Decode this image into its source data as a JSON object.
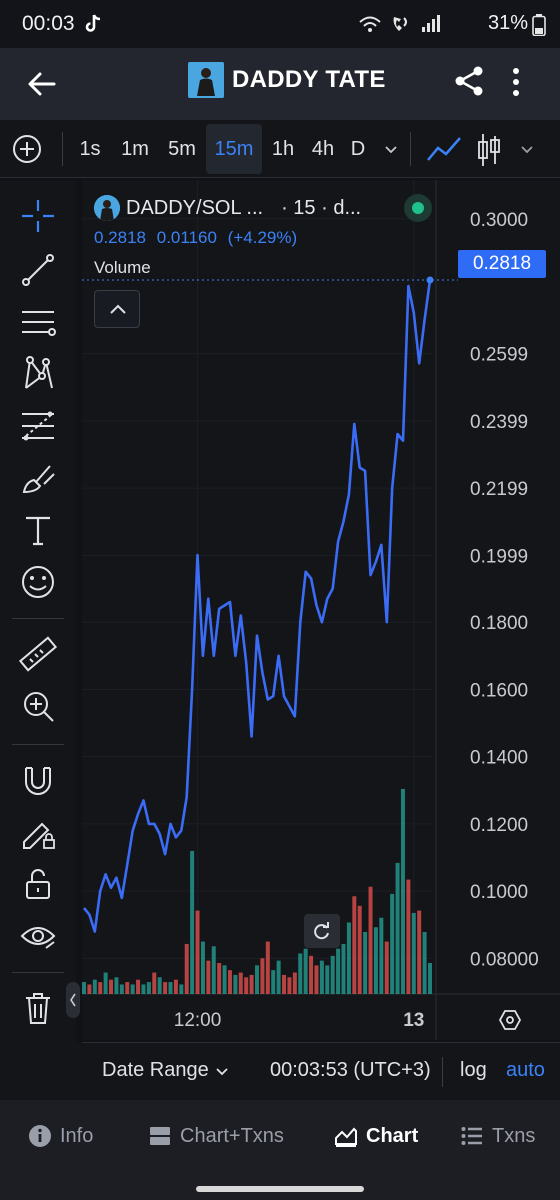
{
  "status_bar": {
    "time": "00:03",
    "battery": "31%"
  },
  "header": {
    "title": "DADDY TATE"
  },
  "toolbar": {
    "timeframes": [
      {
        "label": "1s"
      },
      {
        "label": "1m"
      },
      {
        "label": "5m"
      },
      {
        "label": "15m",
        "active": true
      },
      {
        "label": "1h"
      },
      {
        "label": "4h"
      },
      {
        "label": "D"
      }
    ]
  },
  "legend": {
    "symbol": "DADDY/SOL ...",
    "interval": "· 15 · d...",
    "last_price": "0.2818",
    "change": "0.01160",
    "change_pct": "(+4.29%)",
    "volume_label": "Volume"
  },
  "price_tag": "0.2818",
  "bottom_bar": {
    "date_range": "Date Range",
    "clock": "00:03:53 (UTC+3)",
    "log": "log",
    "auto": "auto"
  },
  "nav": {
    "info": "Info",
    "chart_txns": "Chart+Txns",
    "chart": "Chart",
    "txns": "Txns"
  },
  "colors": {
    "accent": "#3b82f6",
    "up": "#26a69a",
    "down": "#ef5350",
    "line": "#3b6cf6"
  },
  "chart_data": {
    "type": "line",
    "series": [
      {
        "values": [
          0.095,
          0.093,
          0.088,
          0.1,
          0.105,
          0.101,
          0.104,
          0.098,
          0.108,
          0.118,
          0.123,
          0.127,
          0.12,
          0.12,
          0.117,
          0.111,
          0.12,
          0.116,
          0.118,
          0.128,
          0.16,
          0.2,
          0.17,
          0.187,
          0.17,
          0.184,
          0.185,
          0.186,
          0.17,
          0.182,
          0.168,
          0.146,
          0.176,
          0.165,
          0.157,
          0.158,
          0.17,
          0.158,
          0.155,
          0.152,
          0.18,
          0.195,
          0.193,
          0.185,
          0.18,
          0.187,
          0.19,
          0.204,
          0.21,
          0.218,
          0.239,
          0.226,
          0.225,
          0.194,
          0.198,
          0.203,
          0.18,
          0.22,
          0.236,
          0.234,
          0.28,
          0.272,
          0.257,
          0.27,
          0.2818
        ]
      }
    ],
    "volume": [
      0.5,
      0.4,
      0.6,
      0.5,
      0.9,
      0.6,
      0.7,
      0.4,
      0.5,
      0.4,
      0.6,
      0.4,
      0.5,
      0.9,
      0.7,
      0.5,
      0.5,
      0.6,
      0.4,
      2.1,
      6.0,
      3.5,
      2.2,
      1.4,
      2.0,
      1.3,
      1.2,
      1.0,
      0.8,
      0.9,
      0.7,
      0.8,
      1.2,
      1.5,
      2.2,
      1.0,
      1.4,
      0.8,
      0.7,
      0.9,
      1.7,
      1.9,
      1.6,
      1.2,
      1.4,
      1.2,
      1.6,
      1.9,
      2.1,
      3.0,
      4.1,
      3.7,
      2.6,
      4.5,
      2.8,
      3.2,
      2.2,
      4.2,
      5.5,
      8.6,
      4.8,
      3.4,
      3.5,
      2.6,
      1.3
    ],
    "volume_up": [
      true,
      false,
      true,
      false,
      true,
      false,
      true,
      true,
      false,
      true,
      false,
      true,
      true,
      false,
      true,
      false,
      true,
      false,
      true,
      false,
      true,
      false,
      true,
      false,
      true,
      false,
      true,
      false,
      true,
      false,
      false,
      false,
      true,
      false,
      false,
      true,
      true,
      false,
      false,
      false,
      true,
      true,
      false,
      false,
      true,
      true,
      true,
      true,
      true,
      true,
      false,
      false,
      true,
      false,
      true,
      true,
      false,
      true,
      true,
      true,
      false,
      true,
      false,
      true,
      true
    ],
    "ylim": [
      0.07,
      0.305
    ],
    "y_ticks": [
      "0.3000",
      "0.2599",
      "0.2399",
      "0.2199",
      "0.1999",
      "0.1800",
      "0.1600",
      "0.1400",
      "0.1200",
      "0.1000",
      "0.08000"
    ],
    "y_tick_values": [
      0.3,
      0.2599,
      0.2399,
      0.2199,
      0.1999,
      0.18,
      0.16,
      0.14,
      0.12,
      0.1,
      0.08
    ],
    "x_ticks": [
      {
        "label": "12:00",
        "index": 21,
        "bold": false
      },
      {
        "label": "13",
        "index": 61,
        "bold": true
      }
    ]
  }
}
